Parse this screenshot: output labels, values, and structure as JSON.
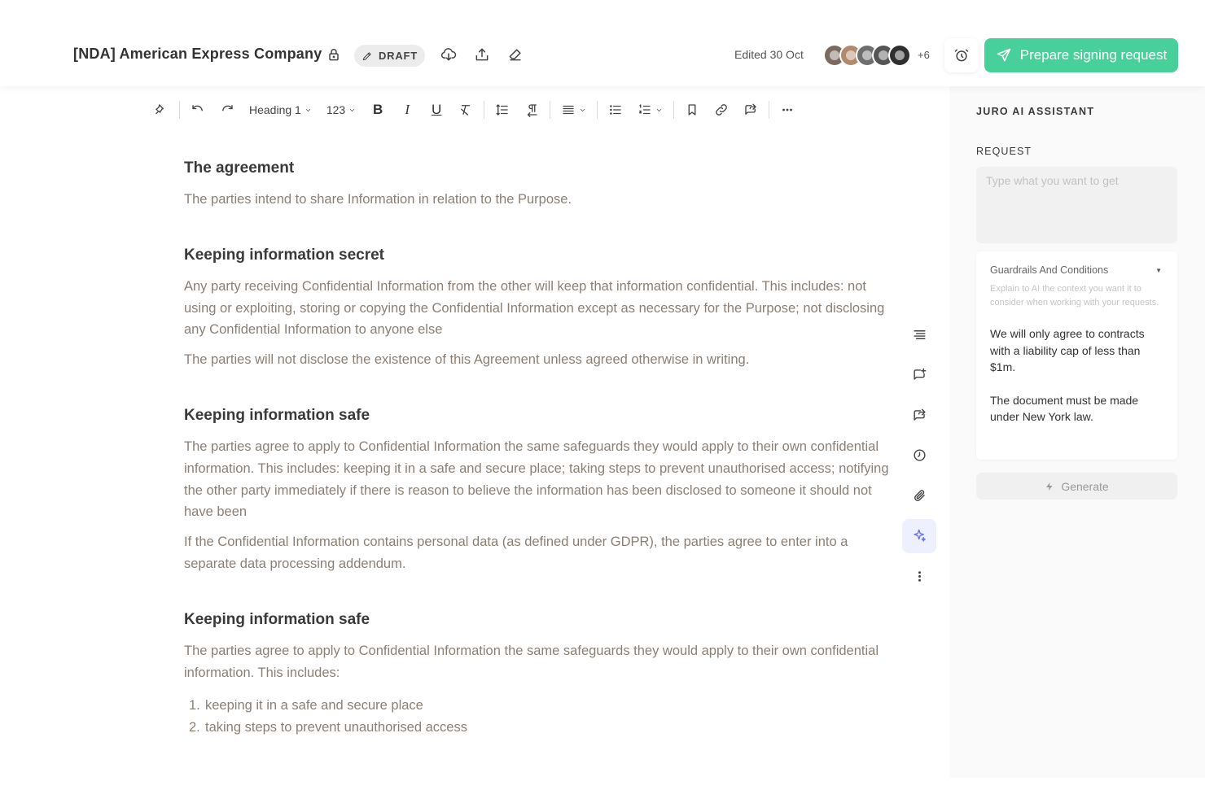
{
  "header": {
    "doc_title": "[NDA] American Express Company",
    "draft_label": "DRAFT",
    "edited": "Edited 30 Oct",
    "avatars": [
      {
        "color": "#7b6b5e"
      },
      {
        "color": "#b08a6a"
      },
      {
        "color": "#6e6e6e"
      },
      {
        "color": "#555555"
      },
      {
        "color": "#2f2f2f"
      }
    ],
    "more_count": "+6",
    "primary_button": "Prepare signing request",
    "primary_color": "#47d09a"
  },
  "toolbar": {
    "heading_select": "Heading 1",
    "number_format": "123",
    "bold": "B",
    "italic": "I",
    "underline": "U"
  },
  "document": {
    "sections": [
      {
        "heading": "The agreement",
        "paragraphs": [
          "The parties intend to share Information in relation to the Purpose."
        ]
      },
      {
        "heading": "Keeping information secret",
        "paragraphs": [
          "Any party receiving Confidential Information from the other will keep that information confidential. This includes: not using or exploiting, storing  or copying the Confidential Information except as necessary for the Purpose; not disclosing any Confidential Information to anyone else",
          "The parties will not disclose the existence of this Agreement unless agreed otherwise in writing."
        ]
      },
      {
        "heading": "Keeping information safe",
        "paragraphs": [
          "The parties agree to apply to Confidential Information the same safeguards they would apply to their own confidential information. This includes: keeping it in a safe and secure place; taking steps to prevent unauthorised access; notifying the other party immediately if there is reason to believe the information has been disclosed to someone it should not have been",
          "If the Confidential Information contains personal data (as defined under GDPR), the parties agree to enter into a separate data processing addendum."
        ]
      },
      {
        "heading": "Keeping information safe",
        "paragraphs": [
          "The parties agree to apply to Confidential Information the same safeguards they would apply to their own confidential information. This includes:"
        ],
        "list": [
          {
            "num": "1.",
            "text": "keeping it in a safe and secure place"
          },
          {
            "num": "2.",
            "text": "taking steps to prevent unauthorised access"
          }
        ]
      }
    ]
  },
  "rail": [
    "align-lines-icon",
    "add-comment-icon",
    "share-comment-icon",
    "history-icon",
    "attachment-icon",
    "ai-sparkle-icon",
    "more-vertical-icon"
  ],
  "assistant": {
    "title": "JURO AI ASSISTANT",
    "request_label": "REQUEST",
    "request_placeholder": "Type what you want to get",
    "guardrails_title": "Guardrails And Conditions",
    "guardrails_hint": "Explain to AI the context you want it to consider when working with your requests.",
    "guardrails": [
      "We will only agree to contracts with a liability cap of less than $1m.",
      "The document must be made under New York law."
    ],
    "generate_label": "Generate"
  }
}
